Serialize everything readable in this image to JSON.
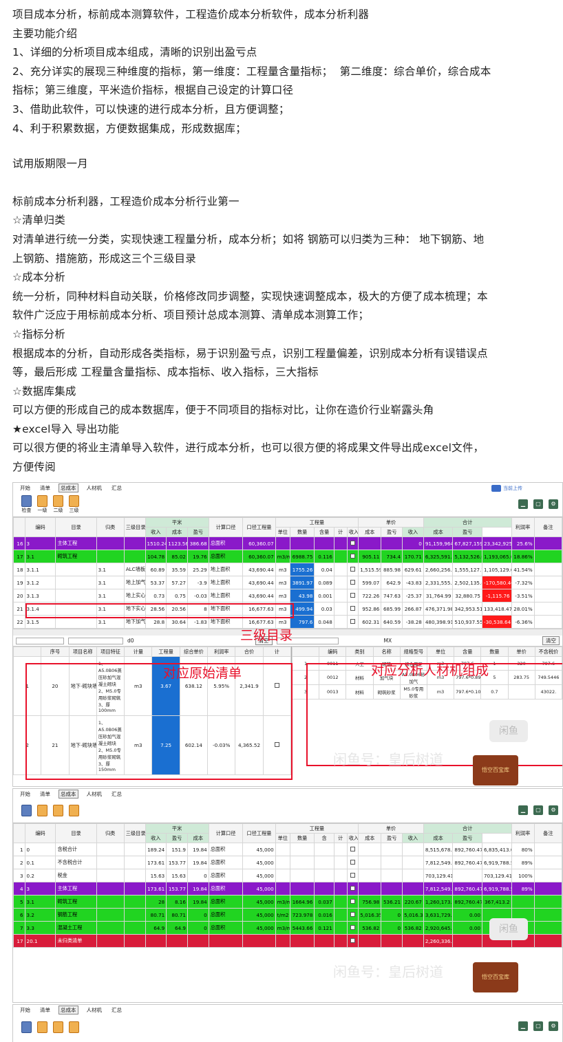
{
  "article": {
    "lines": [
      "项目成本分析，标前成本测算软件，工程造价成本分析软件，成本分析利器",
      "主要功能介绍",
      "1、详细的分析项目成本组成，清晰的识别出盈亏点",
      "2、充分详实的展现三种维度的指标，第一维度：工程量含量指标；  第二维度：综合单价，综合成本",
      "指标；第三维度，平米造价指标，根据自己设定的计算口径",
      "3、借助此软件，可以快速的进行成本分析，且方便调整；",
      "4、利于积累数据，方便数据集成，形成数据库；"
    ],
    "trial": "试用版期限一月",
    "lines2": [
      "标前成本分析利器，工程造价成本分析行业第一",
      "☆清单归类",
      "对清单进行统一分类，实现快速工程量分析，成本分析；如将 钢筋可以归类为三种： 地下钢筋、地",
      "上钢筋、措施筋，形成这三个三级目录",
      "☆成本分析",
      "统一分析，同种材料自动关联，价格修改同步调整，实现快速调整成本，极大的方便了成本梳理；本",
      "软件广泛应于用标前成本分析、项目预计总成本测算、清单成本测算工作；",
      "☆指标分析",
      "根据成本的分析，自动形成各类指标，易于识别盈亏点，识别工程量偏差，识别成本分析有误错误点",
      "等，最后形成 工程量含量指标、成本指标、收入指标，三大指标",
      "☆数据库集成",
      "可以方便的形成自己的成本数据库，便于不同项目的指标对比，让你在造价行业崭露头角",
      "★excel导入 导出功能",
      "可以很方便的将业主清单导入软件，进行成本分析，也可以很方便的将成果文件导出成excel文件，",
      "方便传阅"
    ]
  },
  "menu": [
    "开始",
    "清单",
    "总成本",
    "人材机",
    "汇总"
  ],
  "toolbar1": [
    "检查",
    "一级",
    "二级",
    "三级"
  ],
  "upload_label": "当前上传",
  "shot1": {
    "headers": [
      "编码",
      "目录",
      "归类",
      "三级目录",
      "平米",
      "计算口径",
      "口径工程量",
      "工程量",
      "单价",
      "合计",
      "利润率",
      "备注"
    ],
    "sub": [
      "收入",
      "成本",
      "盈亏",
      "单位",
      "数量",
      "含量",
      "计",
      "收入",
      "成本",
      "盈亏",
      "收入",
      "成本",
      "盈亏"
    ],
    "rows": [
      {
        "n": "16",
        "code": "3",
        "name": "主体工程",
        "cls": "",
        "l3": "",
        "a": "1510.24",
        "b": "1123.56",
        "c": "386.68",
        "k": "总面积",
        "q": "60,360.07",
        "u": "",
        "qty": "",
        "hl": "",
        "ratio": "",
        "in": "",
        "cost": "",
        "pl": "0",
        "tin": "91,159,964.96",
        "tcost": "67,827,159.73",
        "tpl": "23,342,925.23",
        "rate": "25.6%",
        "kind": "purple"
      },
      {
        "n": "17",
        "code": "3.1",
        "name": "砌筑工程",
        "cls": "",
        "l3": "",
        "a": "104.78",
        "b": "85.02",
        "c": "19.76",
        "k": "总面积",
        "q": "60,360.07",
        "u": "m3/m2",
        "qty": "6988.75",
        "hl": "0.116",
        "ratio": "",
        "in": "905.11",
        "cost": "734.4",
        "pl": "170.71",
        "tin": "6,325,591.6",
        "tcost": "5,132,526.0",
        "tpl": "1,193,065.08",
        "rate": "18.86%",
        "kind": "green"
      },
      {
        "n": "18",
        "code": "3.1.1",
        "name": "",
        "cls": "3.1",
        "l3": "ALC墙板",
        "a": "60.89",
        "b": "35.59",
        "c": "25.29",
        "k": "地上面积",
        "q": "43,690.44",
        "u": "m3",
        "qty": "1755.26",
        "hl": "0.04",
        "ratio": "",
        "in": "1,515.59",
        "cost": "885.98",
        "pl": "629.61",
        "tin": "2,660,256.80",
        "tcost": "1,555,127.73",
        "tpl": "1,105,129.07",
        "rate": "41.54%",
        "kind": ""
      },
      {
        "n": "19",
        "code": "3.1.2",
        "name": "",
        "cls": "3.1",
        "l3": "地上加气块墙",
        "a": "53.37",
        "b": "57.27",
        "c": "-3.9",
        "k": "地上面积",
        "q": "43,690.44",
        "u": "m3",
        "qty": "3891.97",
        "hl": "0.089",
        "ratio": "",
        "in": "599.07",
        "cost": "642.9",
        "pl": "-43.83",
        "tin": "2,331,555.36",
        "tcost": "2,502,135.86",
        "tpl": "-170,580.46",
        "rate": "-7.32%",
        "kind": "neg"
      },
      {
        "n": "20",
        "code": "3.1.3",
        "name": "",
        "cls": "3.1",
        "l3": "地上实心砖墙",
        "a": "0.73",
        "b": "0.75",
        "c": "-0.03",
        "k": "地上面积",
        "q": "43,690.44",
        "u": "m3",
        "qty": "43.98",
        "hl": "0.001",
        "ratio": "",
        "in": "722.26",
        "cost": "747.63",
        "pl": "-25.37",
        "tin": "31,764.99",
        "tcost": "32,880.75",
        "tpl": "-1,115.76",
        "rate": "-3.51%",
        "kind": "neg"
      },
      {
        "n": "21",
        "code": "3.1.4",
        "name": "",
        "cls": "3.1",
        "l3": "地下实心砖墙",
        "a": "28.56",
        "b": "20.56",
        "c": "8",
        "k": "地下面积",
        "q": "16,677.63",
        "u": "m3",
        "qty": "499.94",
        "hl": "0.03",
        "ratio": "",
        "in": "952.86",
        "cost": "685.99",
        "pl": "266.87",
        "tin": "476,371.98",
        "tcost": "342,953.51",
        "tpl": "133,418.47",
        "rate": "28.01%",
        "kind": ""
      },
      {
        "n": "22",
        "code": "3.1.5",
        "name": "",
        "cls": "3.1",
        "l3": "地下加气块墙",
        "a": "28.8",
        "b": "30.64",
        "c": "-1.83",
        "k": "地下面积",
        "q": "16,677.63",
        "u": "m3",
        "qty": "797.6",
        "hl": "0.048",
        "ratio": "",
        "in": "602.31",
        "cost": "640.59",
        "pl": "-38.28",
        "tin": "480,398.91",
        "tcost": "510,937.55",
        "tpl": "-30,538.64",
        "rate": "-6.36%",
        "kind": "neg"
      }
    ],
    "search_value": "d0",
    "clear": "清空",
    "unit_label": "MX",
    "bottom_headers": [
      "序号",
      "项目名称",
      "项目特征",
      "计量",
      "工程量",
      "综合单价",
      "利润率",
      "合价",
      "计"
    ],
    "bottom_rows": [
      {
        "n": "1",
        "seq": "20",
        "name": "地下-砌块墙",
        "feat": "1、A5.0B06蒸压砂加气混凝土砌块\n2、M5.0专用砂浆砌筑\n3、厚100mm",
        "unit": "m3",
        "qty": "3.67",
        "price": "638.12",
        "rate": "5.95%",
        "total": "2,341.9"
      },
      {
        "n": "2",
        "seq": "21",
        "name": "地下-砌块墙",
        "feat": "1、A5.0B06蒸压砂加气混凝土砌块\n2、M5.0专用砂浆砌筑\n3、厚150mm",
        "unit": "m3",
        "qty": "7.25",
        "price": "602.14",
        "rate": "-0.03%",
        "total": "4,365.52"
      }
    ],
    "right_headers": [
      "编码",
      "类别",
      "名称",
      "规格型号",
      "单位",
      "含量",
      "数量",
      "单价",
      "不含税价"
    ],
    "right_rows": [
      {
        "n": "1",
        "code": "0011",
        "type": "人工",
        "name": "砌筑",
        "spec": "综合用工",
        "unit": "m3",
        "q": "797.6",
        "c": "1",
        "p": "320",
        "x": "797.6"
      },
      {
        "n": "2",
        "code": "0012",
        "type": "材料",
        "name": "加气块",
        "spec": "A5.0B06砂加气",
        "unit": "m3",
        "q": "797.6*0.895",
        "c": "5",
        "p": "283.75",
        "x": "749.5446"
      },
      {
        "n": "3",
        "code": "0013",
        "type": "材料",
        "name": "砌筑砂浆",
        "spec": "M5.0专用砂浆",
        "unit": "m3",
        "q": "797.6*0.105",
        "c": "0.7",
        "p": "",
        "x": "43022."
      }
    ],
    "label_l3": "三级目录",
    "label_list": "对应原始清单",
    "label_rcj": "对应分析人材机组成"
  },
  "shot2": {
    "headers": [
      "编码",
      "目录",
      "归类",
      "三级目录",
      "平米",
      "计算口径",
      "口径工程量",
      "工程量",
      "单价",
      "合计",
      "利润率",
      "备注"
    ],
    "sub": [
      "收入",
      "盈亏",
      "成本",
      "单位",
      "数量",
      "含",
      "计",
      "收入",
      "成本",
      "盈亏",
      "收入",
      "成本",
      "盈亏"
    ],
    "rows": [
      {
        "n": "1",
        "code": "0",
        "name": "含税合计",
        "a": "189.24",
        "b": "151.9",
        "c": "19.84",
        "k": "总面积",
        "q": "45,000",
        "u": "",
        "qty": "",
        "hl": "",
        "in": "",
        "cost": "",
        "pl": "",
        "tin": "8,515,678.41",
        "tcost": "892,760.47",
        "tpl": "6,835,413.00",
        "rate": "80%",
        "kind": ""
      },
      {
        "n": "2",
        "code": "0.1",
        "name": "不含税合计",
        "a": "173.61",
        "b": "153.77",
        "c": "19.84",
        "k": "总面积",
        "q": "45,000",
        "u": "",
        "qty": "",
        "hl": "",
        "in": "",
        "cost": "",
        "pl": "",
        "tin": "7,812,549.0",
        "tcost": "892,760.47",
        "tpl": "6,919,788.53",
        "rate": "89%",
        "kind": ""
      },
      {
        "n": "3",
        "code": "0.2",
        "name": "税金",
        "a": "15.63",
        "b": "15.63",
        "c": "0",
        "k": "总面积",
        "q": "45,000",
        "u": "",
        "qty": "",
        "hl": "",
        "in": "",
        "cost": "",
        "pl": "",
        "tin": "703,129.41",
        "tcost": "",
        "tpl": "703,129.41",
        "rate": "100%",
        "kind": ""
      },
      {
        "n": "4",
        "code": "3",
        "name": "主体工程",
        "a": "173.61",
        "b": "153.77",
        "c": "19.84",
        "k": "总面积",
        "q": "45,000",
        "u": "",
        "qty": "",
        "hl": "",
        "in": "",
        "cost": "",
        "pl": "",
        "tin": "7,812,549.0",
        "tcost": "892,760.47",
        "tpl": "6,919,788.53",
        "rate": "89%",
        "kind": "purple"
      },
      {
        "n": "5",
        "code": "3.1",
        "name": "砌筑工程",
        "a": "28",
        "b": "8.16",
        "c": "19.84",
        "k": "总面积",
        "q": "45,000",
        "u": "m3/m2",
        "qty": "1664.96",
        "hl": "0.037",
        "in": "756.98",
        "cost": "536.21",
        "pl": "220.67",
        "tin": "1,260,173.6",
        "tcost": "892,760.47",
        "tpl": "367,413.2",
        "rate": "",
        "kind": "green"
      },
      {
        "n": "6",
        "code": "3.2",
        "name": "钢筋工程",
        "a": "80.71",
        "b": "80.71",
        "c": "0",
        "k": "总面积",
        "q": "45,000",
        "u": "t/m2",
        "qty": "723.978",
        "hl": "0.016",
        "in": "5,016.35",
        "cost": "0",
        "pl": "5,016.35",
        "tin": "3,631,729.8",
        "tcost": "0.00",
        "tpl": "",
        "rate": "",
        "kind": "green"
      },
      {
        "n": "7",
        "code": "3.3",
        "name": "混凝土工程",
        "a": "64.9",
        "b": "64.9",
        "c": "0",
        "k": "总面积",
        "q": "45,000",
        "u": "m3/m2",
        "qty": "5443.66",
        "hl": "0.121",
        "in": "536.82",
        "cost": "0",
        "pl": "536.82",
        "tin": "2,920,645.6",
        "tcost": "0.00",
        "tpl": "",
        "rate": "",
        "kind": "green"
      },
      {
        "n": "17",
        "code": "20.1",
        "name": "未归类清单",
        "a": "",
        "b": "",
        "c": "",
        "k": "",
        "q": "",
        "u": "",
        "qty": "",
        "hl": "",
        "in": "",
        "cost": "",
        "pl": "",
        "tin": "2,260,336.8",
        "tcost": "",
        "tpl": "",
        "rate": "",
        "kind": "red"
      }
    ]
  },
  "watermark": "闲鱼号：皇后树道",
  "xianyu": "闲鱼",
  "shop_logo": "悟空百宝库"
}
